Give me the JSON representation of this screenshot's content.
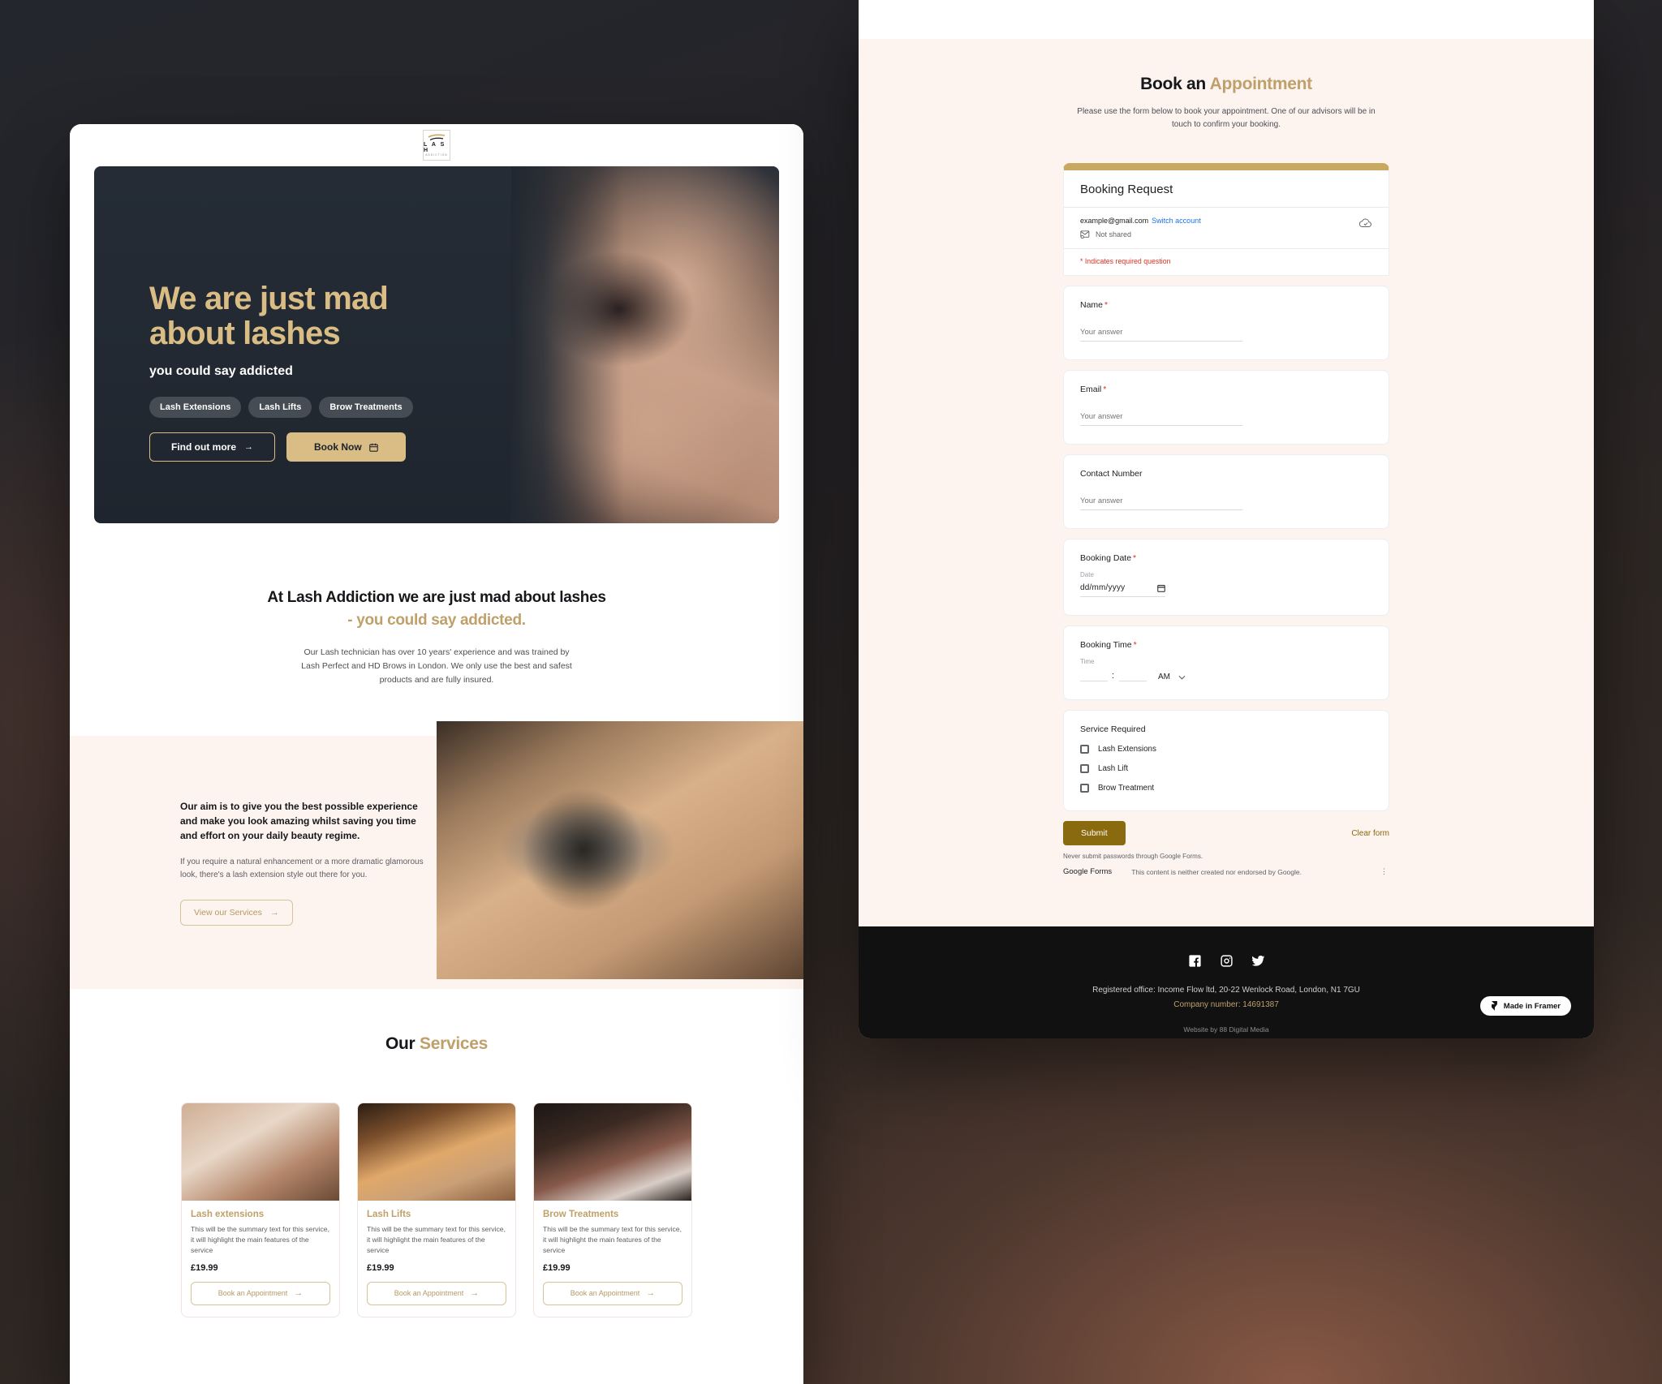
{
  "site": {
    "logo": {
      "wordmark": "L A S H",
      "subtext": "ADDICTION"
    },
    "hero": {
      "heading_line1": "We are just mad",
      "heading_line2": "about lashes",
      "subheading": "you could say addicted",
      "pills": [
        "Lash Extensions",
        "Lash Lifts",
        "Brow Treatments"
      ],
      "primary_button": "Find out more",
      "secondary_button": "Book Now"
    },
    "about": {
      "heading_black": "At Lash Addiction we are just mad about lashes",
      "heading_gold": "- you could say addicted.",
      "body": "Our Lash technician has over 10 years' experience and was trained by Lash Perfect and HD Brows in London. We only use the best and safest products and are fully insured."
    },
    "aim": {
      "heading": "Our aim is to give you the best possible experience and make you look amazing whilst saving you time and effort on your daily beauty regime.",
      "body": "If you require a natural enhancement or a more dramatic glamorous look, there's a lash extension style out there for you.",
      "button": "View our Services"
    },
    "services": {
      "heading_black": "Our ",
      "heading_gold": "Services",
      "cards": [
        {
          "title": "Lash extensions",
          "summary": "This will be the summary text for this service, it will highlight the main features of the service",
          "price": "£19.99",
          "button": "Book an Appointment"
        },
        {
          "title": "Lash Lifts",
          "summary": "This will be the summary text for this service, it will highlight the main features of the service",
          "price": "£19.99",
          "button": "Book an Appointment"
        },
        {
          "title": "Brow Treatments",
          "summary": "This will be the summary text for this service, it will highlight the main features of the service",
          "price": "£19.99",
          "button": "Book an Appointment"
        }
      ]
    }
  },
  "booking": {
    "heading_black": "Book an ",
    "heading_gold": "Appointment",
    "lead": "Please use the form below to book your appointment. One of our advisors will be in touch to confirm your booking.",
    "form": {
      "title": "Booking Request",
      "account_email": "example@gmail.com",
      "switch_account": "Switch account",
      "shared_status": "Not shared",
      "required_note": "* Indicates required question",
      "questions": [
        {
          "label": "Name",
          "required": "*",
          "placeholder": "Your answer"
        },
        {
          "label": "Email",
          "required": "*",
          "placeholder": "Your answer"
        },
        {
          "label": "Contact Number",
          "required": "",
          "placeholder": "Your answer"
        }
      ],
      "date_question": {
        "label": "Booking Date",
        "required": "*",
        "sublabel": "Date",
        "value": "dd/mm/yyyy"
      },
      "time_question": {
        "label": "Booking Time",
        "required": "*",
        "sublabel": "Time",
        "meridiem": "AM",
        "separator": ":"
      },
      "checkbox_question": {
        "label": "Service Required",
        "options": [
          "Lash Extensions",
          "Lash Lift",
          "Brow Treatment"
        ]
      },
      "submit_label": "Submit",
      "clear_label": "Clear form",
      "password_note": "Never submit passwords through Google Forms.",
      "brand": "Google Forms",
      "disclaimer": "This content is neither created nor endorsed by Google."
    }
  },
  "footer": {
    "socials": [
      "facebook-icon",
      "instagram-icon",
      "twitter-icon"
    ],
    "registered_office": "Registered office: Income Flow ltd, 20-22 Wenlock Road, London, N1 7GU",
    "company_number": "Company number: 14691387",
    "credit": "Website by 88 Digital Media",
    "framer_badge": "Made in Framer"
  },
  "colors": {
    "gold": "#bfa06a",
    "hero_gold": "#d9bd85",
    "dark": "#212831",
    "cream": "#fdf3ef",
    "google_blue": "#1a73e8",
    "google_red": "#d93025",
    "submit": "#8a6a0e"
  }
}
